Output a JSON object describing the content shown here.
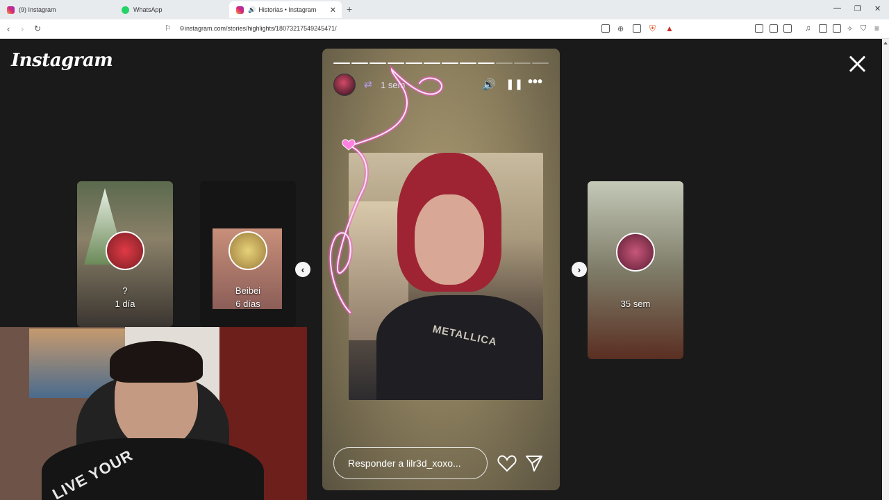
{
  "browser": {
    "tabs": [
      {
        "title": "(9) Instagram"
      },
      {
        "title": "WhatsApp"
      },
      {
        "title": "Historias • Instagram"
      }
    ],
    "url": "instagram.com/stories/highlights/18073217549245471/"
  },
  "page": {
    "logo": "Instagram",
    "left_cards": [
      {
        "title": "?",
        "time": "1 día"
      },
      {
        "title": "Beibei",
        "time": "6 días"
      }
    ],
    "right_card": {
      "time": "35 sem"
    },
    "story": {
      "time": "1 sem",
      "progress_total": 12,
      "progress_done": 9,
      "shirt_text": "METALLICA",
      "reply_placeholder": "Responder a lilr3d_xoxo..."
    },
    "webcam": {
      "text": "LIVE YOUR"
    }
  },
  "colors": {
    "background": "#1a1a1a",
    "story_bg": "#8b7e5d",
    "neon": "#ff4fd8"
  }
}
